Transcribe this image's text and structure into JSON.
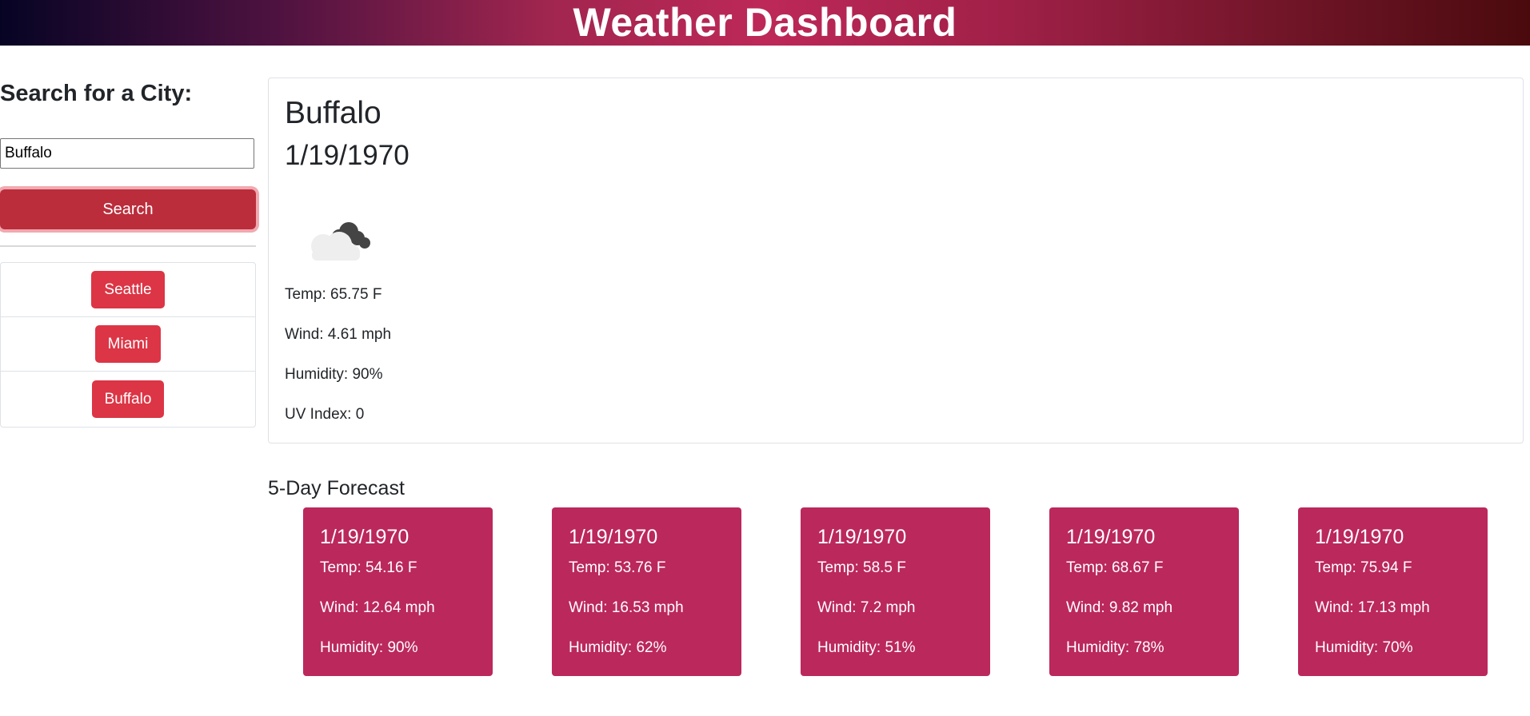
{
  "header": {
    "title": "Weather Dashboard",
    "gradient_colors": [
      "#060424",
      "#bd2858",
      "#4a0a0d"
    ]
  },
  "sidebar": {
    "heading": "Search for a City:",
    "search_value": "Buffalo",
    "search_button_label": "Search",
    "history": [
      {
        "label": "Seattle"
      },
      {
        "label": "Miami"
      },
      {
        "label": "Buffalo"
      }
    ]
  },
  "current": {
    "city": "Buffalo",
    "date": "1/19/1970",
    "icon": "cloudy-icon",
    "temp": "Temp: 65.75 F",
    "wind": "Wind: 4.61 mph",
    "humidity": "Humidity: 90%",
    "uv_index": "UV Index: 0"
  },
  "forecast": {
    "title": "5-Day Forecast",
    "card_color": "#bb285c",
    "days": [
      {
        "date": "1/19/1970",
        "temp": "Temp: 54.16 F",
        "wind": "Wind: 12.64 mph",
        "humidity": "Humidity: 90%"
      },
      {
        "date": "1/19/1970",
        "temp": "Temp: 53.76 F",
        "wind": "Wind: 16.53 mph",
        "humidity": "Humidity: 62%"
      },
      {
        "date": "1/19/1970",
        "temp": "Temp: 58.5 F",
        "wind": "Wind: 7.2 mph",
        "humidity": "Humidity: 51%"
      },
      {
        "date": "1/19/1970",
        "temp": "Temp: 68.67 F",
        "wind": "Wind: 9.82 mph",
        "humidity": "Humidity: 78%"
      },
      {
        "date": "1/19/1970",
        "temp": "Temp: 75.94 F",
        "wind": "Wind: 17.13 mph",
        "humidity": "Humidity: 70%"
      }
    ]
  }
}
